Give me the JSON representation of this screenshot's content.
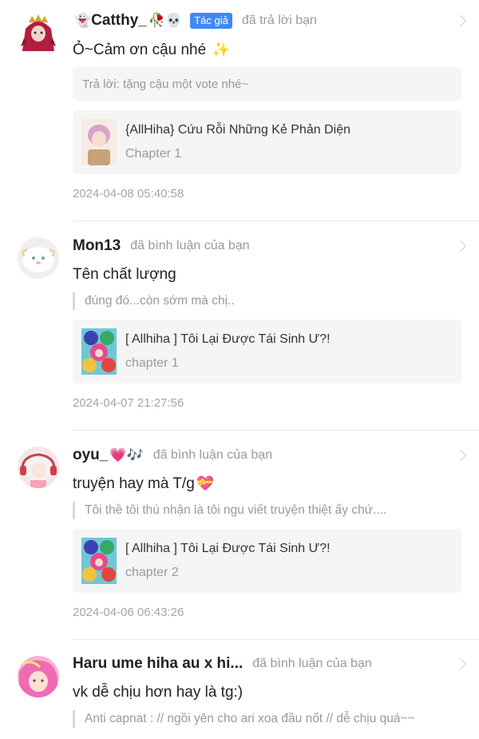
{
  "notifications": [
    {
      "username": "Catthy_",
      "prefix_emoji": "👻",
      "suffix_emoji": "🥀💀",
      "badge": "Tác giả",
      "action": "đã trả lời bạn",
      "message": "Ỏ~Cảm ơn cậu nhé",
      "message_emoji": "✨",
      "quote": "Trả lời: tặng cậu một vote nhé~",
      "story_title": "{AllHiha} Cứu Rỗi Những Kẻ Phản Diện",
      "chapter": "Chapter 1",
      "timestamp": "2024-04-08 05:40:58"
    },
    {
      "username": "Mon13",
      "action": "đã bình luận của bạn",
      "message": "Tên chất lượng",
      "quote": "đúng đó...còn sớm mà chị..",
      "story_title": "[ Allhiha ] Tôi Lại Được Tái Sinh Ư?!",
      "chapter": "chapter 1",
      "timestamp": "2024-04-07 21:27:56"
    },
    {
      "username": "oyu_",
      "suffix_emoji": "💗🎶",
      "action": "đã bình luận của bạn",
      "message": "truyện hay mà T/g",
      "message_emoji": "💝",
      "quote": "Tôi thề tôi thú nhận là tôi ngu viết truyện thiệt ấy chứ....",
      "story_title": "[ Allhiha ] Tôi Lại Được Tái Sinh Ư?!",
      "chapter": "chapter 2",
      "timestamp": "2024-04-06 06:43:26"
    },
    {
      "username": "Haru ume hiha au x hi...",
      "action": "đã bình luận của bạn",
      "message": "vk dễ chịu hơn hay là tg:)",
      "quote": "Anti capnat : // ngồi yên cho ari xoa đầu nốt // dễ chịu quá~~"
    }
  ]
}
